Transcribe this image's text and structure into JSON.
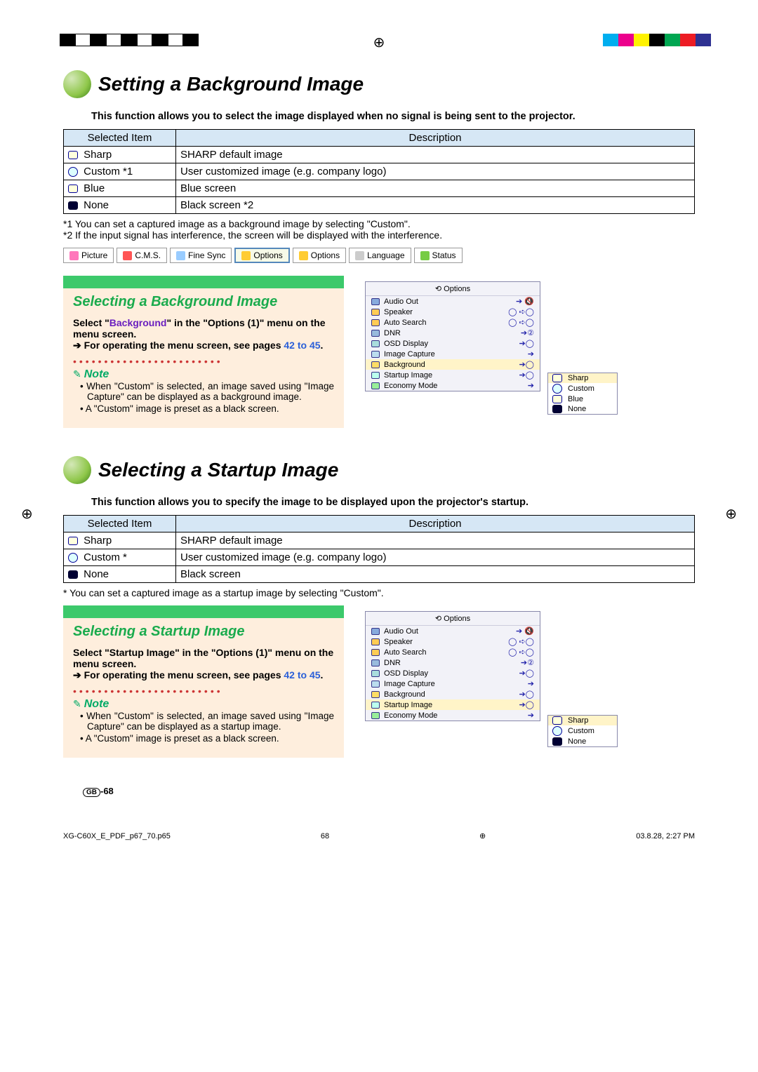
{
  "printerMarks": {
    "bw": [
      "#000",
      "#fff",
      "#000",
      "#fff",
      "#000",
      "#fff",
      "#000",
      "#fff",
      "#000"
    ],
    "colors": [
      "#00aeef",
      "#ec008c",
      "#fff200",
      "#000",
      "#00a651",
      "#ed1c24",
      "#2e3192",
      "#fff"
    ]
  },
  "section1": {
    "title": "Setting a Background Image",
    "intro": "This function allows you to select the image displayed when no signal is being sent to the projector.",
    "tableHeaders": {
      "c1": "Selected Item",
      "c2": "Description"
    },
    "rows": [
      {
        "icon": "square",
        "label": "Sharp",
        "desc": "SHARP default image"
      },
      {
        "icon": "circle",
        "label": "Custom *1",
        "desc": "User customized image (e.g. company logo)"
      },
      {
        "icon": "square",
        "label": "Blue",
        "desc": "Blue screen"
      },
      {
        "icon": "filled",
        "label": "None",
        "desc": "Black screen *2"
      }
    ],
    "foot1": "*1 You can set a captured image as a background image by selecting \"Custom\".",
    "foot2": "*2 If the input signal has interference, the screen will be displayed with the interference.",
    "menuTabs": [
      "Picture",
      "C.M.S.",
      "Fine Sync",
      "Options",
      "Options",
      "Language",
      "Status"
    ],
    "sub": {
      "heading": "Selecting a Background Image",
      "line1a": "Select \"",
      "line1b": "Background",
      "line1c": "\" in the \"Options (1)\" menu on the menu screen.",
      "line2a": "➔ For operating the menu screen, see pages ",
      "line2b": "42 to 45",
      "line2c": ".",
      "noteLabel": "Note",
      "notes": [
        "• When \"Custom\" is selected, an image saved using \"Image Capture\" can be displayed as a background image.",
        "• A \"Custom\" image is preset as a black screen."
      ]
    },
    "osd": {
      "title": "Options",
      "rows": [
        {
          "icon": "#8ad",
          "label": "Audio Out",
          "val": "➔ 🔇"
        },
        {
          "icon": "#fc5",
          "label": "Speaker",
          "val": "◯   ➪◯"
        },
        {
          "icon": "#fc5",
          "label": "Auto Search",
          "val": "◯   ➪◯"
        },
        {
          "icon": "#9bd",
          "label": "DNR",
          "val": "➔②"
        },
        {
          "icon": "#add",
          "label": "OSD Display",
          "val": "➔◯"
        },
        {
          "icon": "#bde",
          "label": "Image Capture",
          "val": "➔"
        },
        {
          "icon": "#fd6",
          "label": "Background",
          "val": "➔◯",
          "hl": true
        },
        {
          "icon": "#bfe",
          "label": "Startup Image",
          "val": "➔◯"
        },
        {
          "icon": "#9e9",
          "label": "Economy Mode",
          "val": "➔"
        }
      ],
      "popup": [
        {
          "icon": "square",
          "label": "Sharp"
        },
        {
          "icon": "circle",
          "label": "Custom"
        },
        {
          "icon": "square",
          "label": "Blue"
        },
        {
          "icon": "filled",
          "label": "None"
        }
      ]
    }
  },
  "section2": {
    "title": "Selecting a Startup Image",
    "intro": "This function allows you to specify the image to be displayed upon the projector's startup.",
    "tableHeaders": {
      "c1": "Selected Item",
      "c2": "Description"
    },
    "rows": [
      {
        "icon": "square",
        "label": "Sharp",
        "desc": "SHARP default image"
      },
      {
        "icon": "circle",
        "label": "Custom *",
        "desc": "User customized image (e.g. company logo)"
      },
      {
        "icon": "filled",
        "label": "None",
        "desc": "Black screen"
      }
    ],
    "foot1": "* You can set a captured image as a startup image by selecting \"Custom\".",
    "sub": {
      "heading": "Selecting a Startup Image",
      "line1a": "Select \"Startup Image\" in the \"Options (1)\" menu on the menu screen.",
      "line2a": "➔ For operating the menu screen, see pages ",
      "line2b": "42 to 45",
      "line2c": ".",
      "noteLabel": "Note",
      "notes": [
        "• When \"Custom\" is selected, an image saved using \"Image Capture\" can be displayed as a startup image.",
        "• A \"Custom\" image is preset as a black screen."
      ]
    },
    "osd": {
      "title": "Options",
      "rows": [
        {
          "icon": "#8ad",
          "label": "Audio Out",
          "val": "➔ 🔇"
        },
        {
          "icon": "#fc5",
          "label": "Speaker",
          "val": "◯   ➪◯"
        },
        {
          "icon": "#fc5",
          "label": "Auto Search",
          "val": "◯   ➪◯"
        },
        {
          "icon": "#9bd",
          "label": "DNR",
          "val": "➔②"
        },
        {
          "icon": "#add",
          "label": "OSD Display",
          "val": "➔◯"
        },
        {
          "icon": "#bde",
          "label": "Image Capture",
          "val": "➔"
        },
        {
          "icon": "#fd6",
          "label": "Background",
          "val": "➔◯"
        },
        {
          "icon": "#bfe",
          "label": "Startup Image",
          "val": "➔◯",
          "hl": true
        },
        {
          "icon": "#9e9",
          "label": "Economy Mode",
          "val": "➔"
        }
      ],
      "popup": [
        {
          "icon": "square",
          "label": "Sharp"
        },
        {
          "icon": "circle",
          "label": "Custom"
        },
        {
          "icon": "filled",
          "label": "None"
        }
      ]
    }
  },
  "pageNum": "-68",
  "gbIcon": "GB",
  "docFoot": {
    "file": "XG-C60X_E_PDF_p67_70.p65",
    "page": "68",
    "ts": "03.8.28, 2:27 PM"
  }
}
